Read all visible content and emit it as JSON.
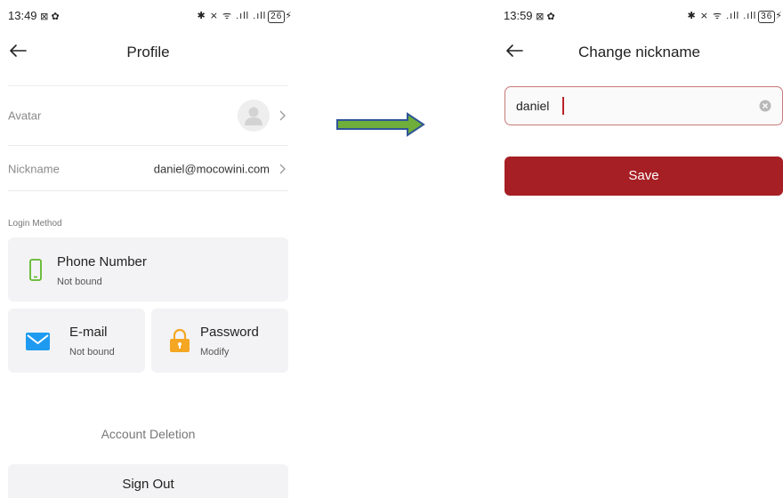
{
  "left_screen": {
    "status_bar": {
      "time": "13:49",
      "notif_icons": "⊠ ✿",
      "icons": "✱ ⨯ ᯤ .ıll .ıll",
      "battery": "26",
      "charging": "⚡"
    },
    "header": {
      "title": "Profile",
      "back_icon": "arrow-left-icon"
    },
    "rows": {
      "avatar": {
        "label": "Avatar"
      },
      "nickname": {
        "label": "Nickname",
        "value": "daniel@mocowini.com"
      }
    },
    "login_method": {
      "section_label": "Login Method",
      "phone": {
        "title": "Phone Number",
        "status": "Not bound",
        "icon": "phone-icon",
        "color": "#5fb82c"
      },
      "email": {
        "title": "E-mail",
        "status": "Not bound",
        "icon": "envelope-icon",
        "color": "#1e9bf0"
      },
      "password": {
        "title": "Password",
        "status": "Modify",
        "icon": "padlock-icon",
        "color": "#f5a623"
      }
    },
    "account_deletion": "Account Deletion",
    "sign_out": "Sign Out"
  },
  "arrow": {
    "color_fill": "#6fae3a",
    "color_stroke": "#2f5597"
  },
  "right_screen": {
    "status_bar": {
      "time": "13:59",
      "notif_icons": "⊠ ✿",
      "icons": "✱ ⨯ ᯤ .ıll .ıll",
      "battery": "36",
      "charging": "⚡"
    },
    "header": {
      "title": "Change nickname",
      "back_icon": "arrow-left-icon"
    },
    "nickname_input": {
      "value": "daniel",
      "placeholder": ""
    },
    "save_label": "Save",
    "accent_color": "#a61f24"
  }
}
